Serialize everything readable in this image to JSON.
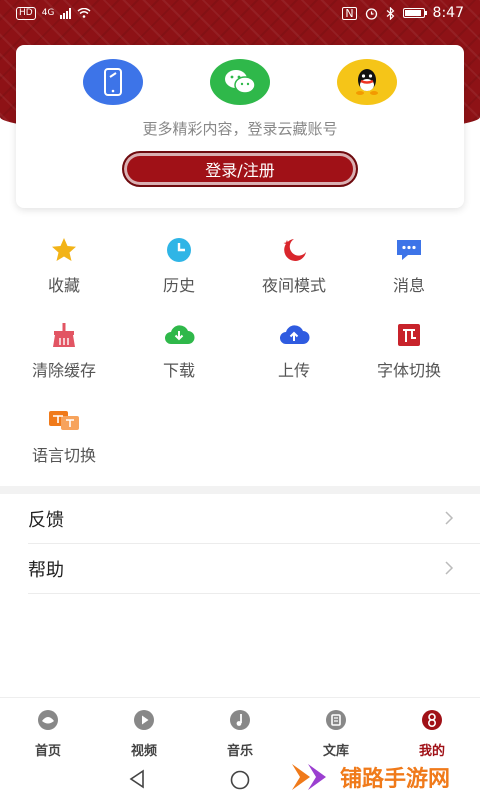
{
  "status": {
    "time": "8:47",
    "network_badge": "HD",
    "network_type": "4G"
  },
  "login_card": {
    "tagline": "更多精彩内容，登录云藏账号",
    "login_button": "登录/注册",
    "methods": [
      {
        "icon": "phone-icon",
        "color": "#3d74e8"
      },
      {
        "icon": "wechat-icon",
        "color": "#2fb84a"
      },
      {
        "icon": "qq-icon",
        "color": "#f5c518"
      }
    ]
  },
  "features": [
    {
      "label": "收藏",
      "icon": "star-icon",
      "color": "#f2b317"
    },
    {
      "label": "历史",
      "icon": "clock-icon",
      "color": "#2fb5e6"
    },
    {
      "label": "夜间模式",
      "icon": "moon-icon",
      "color": "#d9262c"
    },
    {
      "label": "消息",
      "icon": "message-icon",
      "color": "#3d74e8"
    },
    {
      "label": "清除缓存",
      "icon": "broom-icon",
      "color": "#e25563"
    },
    {
      "label": "下载",
      "icon": "download-cloud-icon",
      "color": "#2fb84a"
    },
    {
      "label": "上传",
      "icon": "upload-cloud-icon",
      "color": "#2f5be0"
    },
    {
      "label": "字体切换",
      "icon": "font-icon",
      "color": "#c8232b"
    },
    {
      "label": "语言切换",
      "icon": "language-icon",
      "color": "#f07a1a"
    }
  ],
  "menu": [
    {
      "label": "反馈"
    },
    {
      "label": "帮助"
    }
  ],
  "tabs": [
    {
      "label": "首页",
      "icon": "home-icon"
    },
    {
      "label": "视频",
      "icon": "video-icon"
    },
    {
      "label": "音乐",
      "icon": "music-icon"
    },
    {
      "label": "文库",
      "icon": "library-icon"
    },
    {
      "label": "我的",
      "icon": "profile-icon",
      "active": true
    }
  ],
  "watermark": {
    "text": "铺路手游网"
  },
  "colors": {
    "brand": "#a01117",
    "header": "#8e1216"
  }
}
